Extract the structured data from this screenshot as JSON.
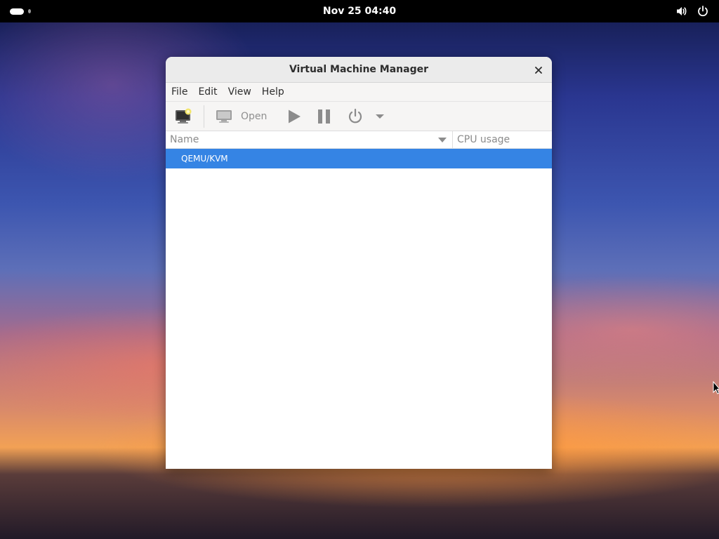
{
  "topbar": {
    "clock": "Nov 25  04:40",
    "icons": [
      "activities-indicator",
      "volume-icon",
      "power-icon"
    ]
  },
  "window": {
    "title": "Virtual Machine Manager",
    "menu": [
      "File",
      "Edit",
      "View",
      "Help"
    ],
    "toolbar": {
      "icons": [
        "new-vm-icon",
        "monitor-icon",
        "play-icon",
        "pause-icon",
        "power-icon",
        "dropdown-arrow-icon"
      ],
      "open_label": "Open"
    },
    "columns": {
      "name": "Name",
      "cpu": "CPU usage"
    },
    "rows": [
      {
        "name": "QEMU/KVM",
        "selected": true
      }
    ]
  },
  "colors": {
    "selection": "#3584e4",
    "titlebar": "#ebebeb",
    "toolbar": "#f6f5f4"
  }
}
